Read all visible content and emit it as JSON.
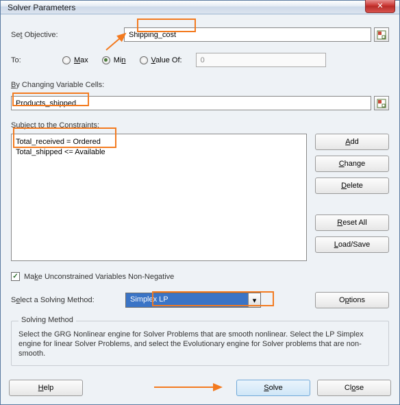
{
  "titlebar": {
    "title": "Solver Parameters"
  },
  "objective": {
    "label_pre": "Se",
    "label_acc": "t",
    "label_post": " Objective:",
    "value": "Shipping_cost"
  },
  "to": {
    "label": "To:",
    "max_acc": "M",
    "max_post": "ax",
    "min_pre": "Mi",
    "min_acc": "n",
    "valof_acc": "V",
    "valof_post": "alue Of:",
    "value_of_input": "0"
  },
  "changing": {
    "label_acc": "B",
    "label_post": "y Changing Variable Cells:",
    "value": "Products_shipped"
  },
  "constraints": {
    "label_pre": "S",
    "label_acc": "u",
    "label_post": "bject to the Constraints:",
    "items": [
      "Total_received = Ordered",
      "Total_shipped <= Available"
    ]
  },
  "side_buttons": {
    "add_acc": "A",
    "add_post": "dd",
    "change_acc": "C",
    "change_post": "hange",
    "delete_acc": "D",
    "delete_post": "elete",
    "reset_acc": "R",
    "reset_post": "eset All",
    "load_acc": "L",
    "load_post": "oad/Save"
  },
  "make_nonneg": {
    "label_pre": "Ma",
    "label_acc": "k",
    "label_post": "e Unconstrained Variables Non-Negative"
  },
  "method": {
    "label_pre": "S",
    "label_acc": "e",
    "label_post": "lect a Solving Method:",
    "selected": "Simplex LP",
    "options_pre": "O",
    "options_acc": "p",
    "options_post": "tions"
  },
  "groupbox": {
    "title": "Solving Method",
    "body": "Select the GRG Nonlinear engine for Solver Problems that are smooth nonlinear. Select the LP Simplex engine for linear Solver Problems, and select the Evolutionary engine for Solver problems that are non-smooth."
  },
  "footer": {
    "help_acc": "H",
    "help_post": "elp",
    "solve_acc": "S",
    "solve_post": "olve",
    "close_pre": "Cl",
    "close_acc": "o",
    "close_post": "se"
  }
}
